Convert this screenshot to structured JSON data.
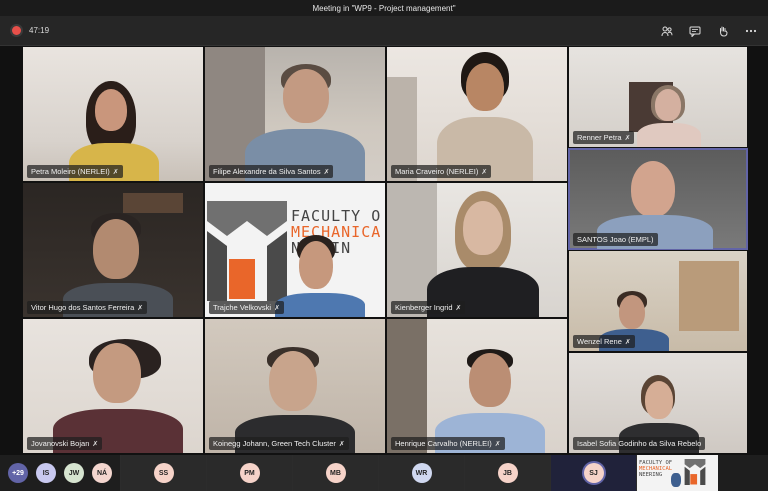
{
  "window": {
    "title": "Meeting in \"WP9 - Project management\""
  },
  "toolbar": {
    "timer": "47:19",
    "buttons": [
      "people-icon",
      "chat-icon",
      "raise-hand-icon",
      "more-icon"
    ]
  },
  "participants": [
    {
      "name": "Petra Moleiro (NERLEI)"
    },
    {
      "name": "Filipe Alexandre da Silva Santos"
    },
    {
      "name": "Maria Craveiro (NERLEI)"
    },
    {
      "name": "Renner Petra"
    },
    {
      "name": "SANTOS Joao (EMPL)"
    },
    {
      "name": "Vitor Hugo dos Santos Ferreira"
    },
    {
      "name": "Trajche  Velkovski"
    },
    {
      "name": "Kienberger Ingrid"
    },
    {
      "name": "Wenzel Rene"
    },
    {
      "name": "Jovanovski Bojan"
    },
    {
      "name": "Koinegg Johann, Green Tech Cluster"
    },
    {
      "name": "Henrique Carvalho (NERLEI)"
    },
    {
      "name": "Isabel Sofia Godinho da Silva Rebelo"
    }
  ],
  "share_screen": {
    "line1": "FACULTY O",
    "line2": "MECHANICA",
    "line3": "NEERIN"
  },
  "mini_logo": {
    "line1": "FACULTY OF",
    "line2": "MECHANICAL",
    "line3": "NEERING"
  },
  "roster": {
    "more": "+29",
    "avatars": [
      "IS",
      "JW",
      "NÁ",
      "SS",
      "PM",
      "MB",
      "WR",
      "JB",
      "SJ"
    ]
  },
  "colors": {
    "accent": "#6264a7",
    "rec": "#e8504a",
    "orange": "#e9662a"
  }
}
